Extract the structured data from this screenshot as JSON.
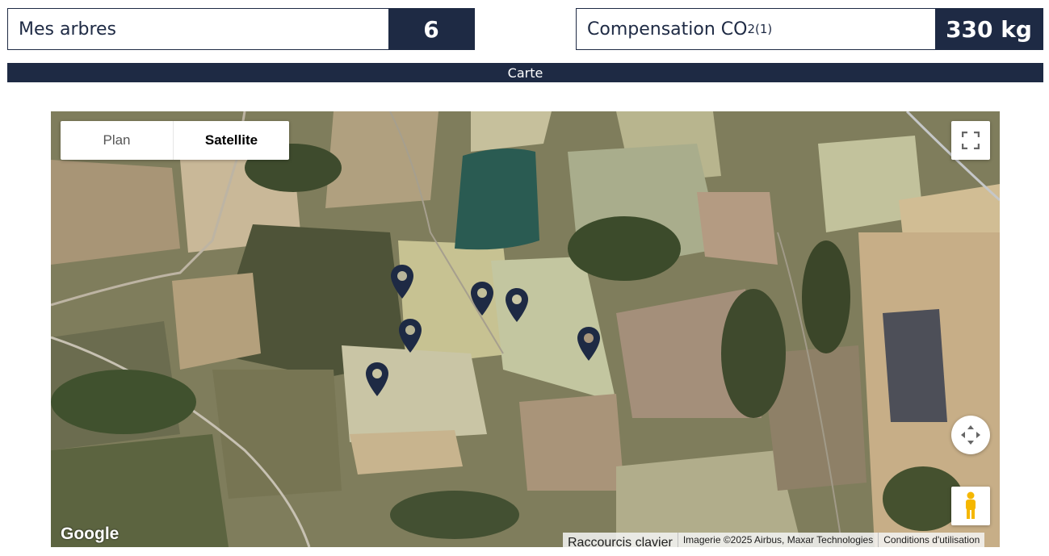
{
  "stats": {
    "trees_label": "Mes arbres",
    "trees_value": "6",
    "co2_label": "Compensation CO",
    "co2_sub": "2",
    "co2_sup": "(1)",
    "co2_value": "330 kg"
  },
  "section": {
    "title": "Carte"
  },
  "map": {
    "type_plan_label": "Plan",
    "type_satellite_label": "Satellite",
    "selected_type": "Satellite",
    "logo_text": "Google",
    "keyboard_shortcuts": "Raccourcis clavier",
    "imagery_credit": "Imagerie ©2025 Airbus, Maxar Technologies",
    "terms": "Conditions d'utilisation",
    "pin_color": "#1e2a44",
    "marker_count": 6
  },
  "colors": {
    "brand_dark": "#1e2a44"
  }
}
